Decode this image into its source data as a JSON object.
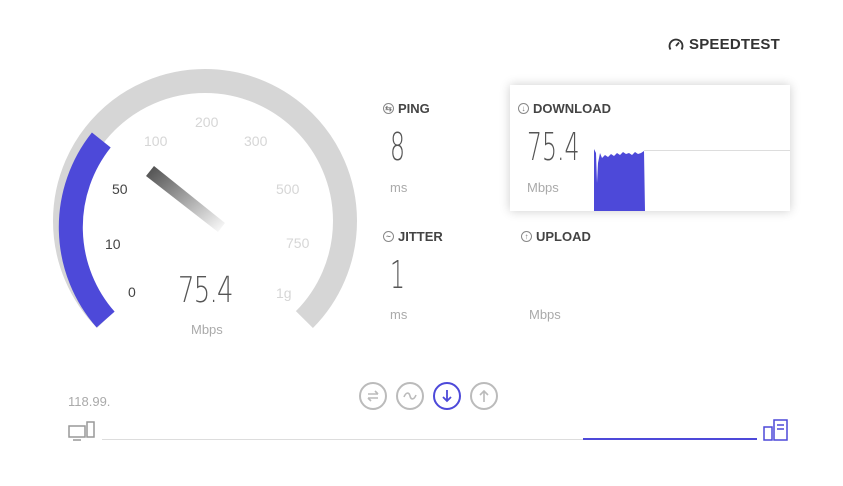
{
  "brand": {
    "name": "SPEEDTEST",
    "icon": "gauge-icon"
  },
  "gauge": {
    "value": "75.4",
    "unit": "Mbps",
    "ticks": [
      "0",
      "10",
      "50",
      "100",
      "200",
      "300",
      "500",
      "750",
      "1g"
    ],
    "active_color": "#4d49d9",
    "track_color": "#d6d6d6"
  },
  "ping": {
    "label": "PING",
    "value": "8",
    "unit": "ms",
    "icon": "ping-icon"
  },
  "jitter": {
    "label": "JITTER",
    "value": "1",
    "unit": "ms",
    "icon": "jitter-icon"
  },
  "download": {
    "label": "DOWNLOAD",
    "value": "75.4",
    "unit": "Mbps",
    "icon": "download-icon"
  },
  "upload": {
    "label": "UPLOAD",
    "value": "",
    "unit": "Mbps",
    "icon": "upload-icon"
  },
  "footer": {
    "server_ip": "118.99.",
    "steps": [
      "ping-step-icon",
      "jitter-step-icon",
      "download-step-icon",
      "upload-step-icon"
    ],
    "active_step": "download",
    "progress_fraction": 0.27
  }
}
